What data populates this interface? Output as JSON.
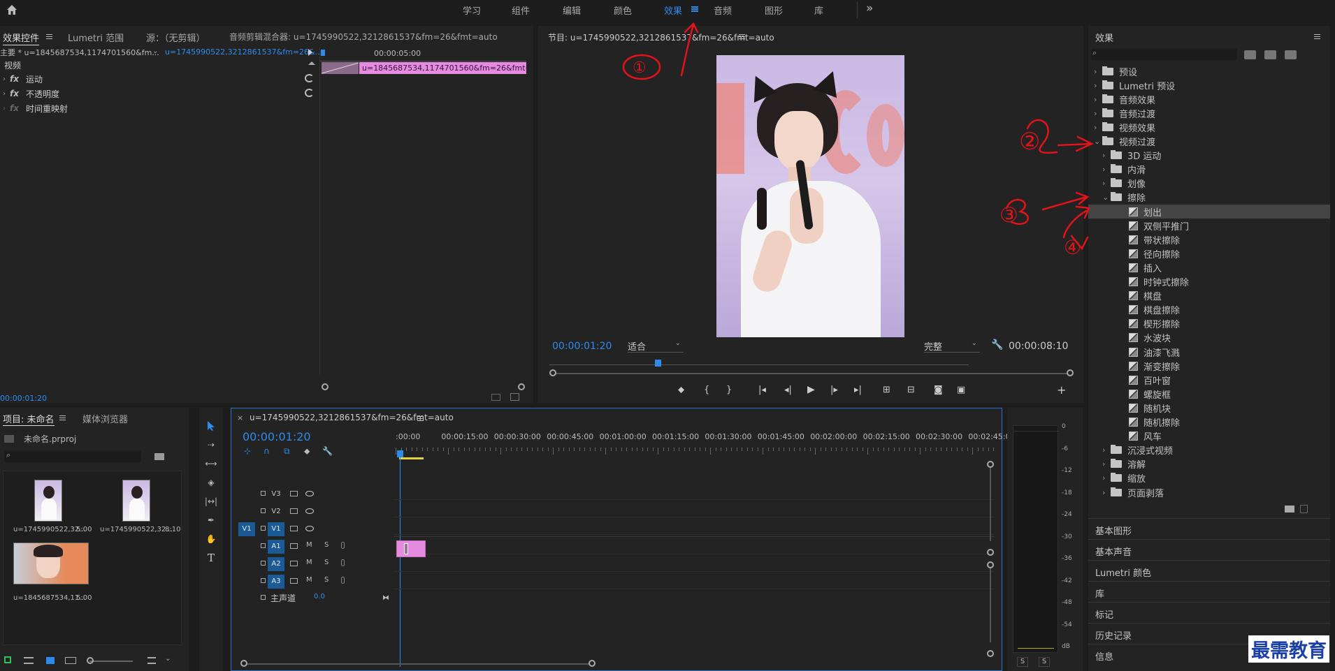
{
  "topnav": {
    "items": [
      "学习",
      "组件",
      "编辑",
      "颜色",
      "效果",
      "音频",
      "图形",
      "库"
    ],
    "active": "效果",
    "more": "»"
  },
  "effect_controls": {
    "tabs": [
      "效果控件",
      "Lumetri 范围",
      "源：（无剪辑）",
      "音频剪辑混合器: u=1745990522,3212861537&fm=26&fmt=auto"
    ],
    "master": "主要 * u=1845687534,1174701560&fm...",
    "sequence": "u=1745990522,3212861537&fm=26&...",
    "video_label": "视频",
    "rows": [
      "运动",
      "不透明度",
      "时间重映射"
    ],
    "timecode_ruler": "00:00:05:00",
    "clip_label": "u=1845687534,1174701560&fm=26&fmt=auto.",
    "current_time": "00:00:01:20"
  },
  "program": {
    "title": "节目: u=1745990522,3212861537&fm=26&fmt=auto",
    "timecode": "00:00:01:20",
    "fit": "适合",
    "quality": "完整",
    "duration": "00:00:08:10"
  },
  "project": {
    "tabs": [
      "项目: 未命名",
      "媒体浏览器"
    ],
    "file": "未命名.prproj",
    "items": [
      {
        "name": "u=1745990522,32...",
        "duration": "5:00"
      },
      {
        "name": "u=1745990522,32...",
        "duration": "8:10"
      },
      {
        "name": "u=1845687534,11...",
        "duration": "5:00"
      }
    ]
  },
  "timeline": {
    "title": "u=1745990522,3212861537&fm=26&fmt=auto",
    "timecode": "00:00:01:20",
    "ruler": [
      ":00:00",
      "00:00:15:00",
      "00:00:30:00",
      "00:00:45:00",
      "00:01:00:00",
      "00:01:15:00",
      "00:01:30:00",
      "00:01:45:00",
      "00:02:00:00",
      "00:02:15:00",
      "00:02:30:00",
      "00:02:45:0"
    ],
    "video_tracks": [
      "V3",
      "V2",
      "V1"
    ],
    "audio_tracks": [
      "A1",
      "A2",
      "A3"
    ],
    "source_v": "V1",
    "master": "主声道",
    "master_val": "0.0",
    "m": "M",
    "s": "S"
  },
  "meter": {
    "scale": [
      "0",
      "-6",
      "-12",
      "-18",
      "-24",
      "-30",
      "-36",
      "-42",
      "-48",
      "-54",
      "dB"
    ],
    "solo": "S"
  },
  "effects": {
    "title": "效果",
    "tree": [
      {
        "label": "预设",
        "level": 0,
        "open": false
      },
      {
        "label": "Lumetri 预设",
        "level": 0,
        "open": false
      },
      {
        "label": "音频效果",
        "level": 0,
        "open": false
      },
      {
        "label": "音频过渡",
        "level": 0,
        "open": false
      },
      {
        "label": "视频效果",
        "level": 0,
        "open": false
      },
      {
        "label": "视频过渡",
        "level": 0,
        "open": true
      },
      {
        "label": "3D 运动",
        "level": 1,
        "open": false
      },
      {
        "label": "内滑",
        "level": 1,
        "open": false
      },
      {
        "label": "划像",
        "level": 1,
        "open": false
      },
      {
        "label": "擦除",
        "level": 1,
        "open": true
      },
      {
        "label": "划出",
        "level": 2,
        "selected": true
      },
      {
        "label": "双侧平推门",
        "level": 2
      },
      {
        "label": "带状擦除",
        "level": 2
      },
      {
        "label": "径向擦除",
        "level": 2
      },
      {
        "label": "插入",
        "level": 2
      },
      {
        "label": "时钟式擦除",
        "level": 2
      },
      {
        "label": "棋盘",
        "level": 2
      },
      {
        "label": "棋盘擦除",
        "level": 2
      },
      {
        "label": "楔形擦除",
        "level": 2
      },
      {
        "label": "水波块",
        "level": 2
      },
      {
        "label": "油漆飞溅",
        "level": 2
      },
      {
        "label": "渐变擦除",
        "level": 2
      },
      {
        "label": "百叶窗",
        "level": 2
      },
      {
        "label": "螺旋框",
        "level": 2
      },
      {
        "label": "随机块",
        "level": 2
      },
      {
        "label": "随机擦除",
        "level": 2
      },
      {
        "label": "风车",
        "level": 2
      },
      {
        "label": "沉浸式视频",
        "level": 1,
        "open": false
      },
      {
        "label": "溶解",
        "level": 1,
        "open": false
      },
      {
        "label": "缩放",
        "level": 1,
        "open": false
      },
      {
        "label": "页面剥落",
        "level": 1,
        "open": false
      }
    ],
    "sections": [
      "基本图形",
      "基本声音",
      "Lumetri 颜色",
      "库",
      "标记",
      "历史记录",
      "信息"
    ]
  },
  "annotations": [
    "①",
    "②",
    "③",
    "④"
  ],
  "watermark": "最需教育",
  "colors": {
    "accent": "#2d8ceb",
    "clip": "#e58be0",
    "annotation": "#e0141a"
  }
}
